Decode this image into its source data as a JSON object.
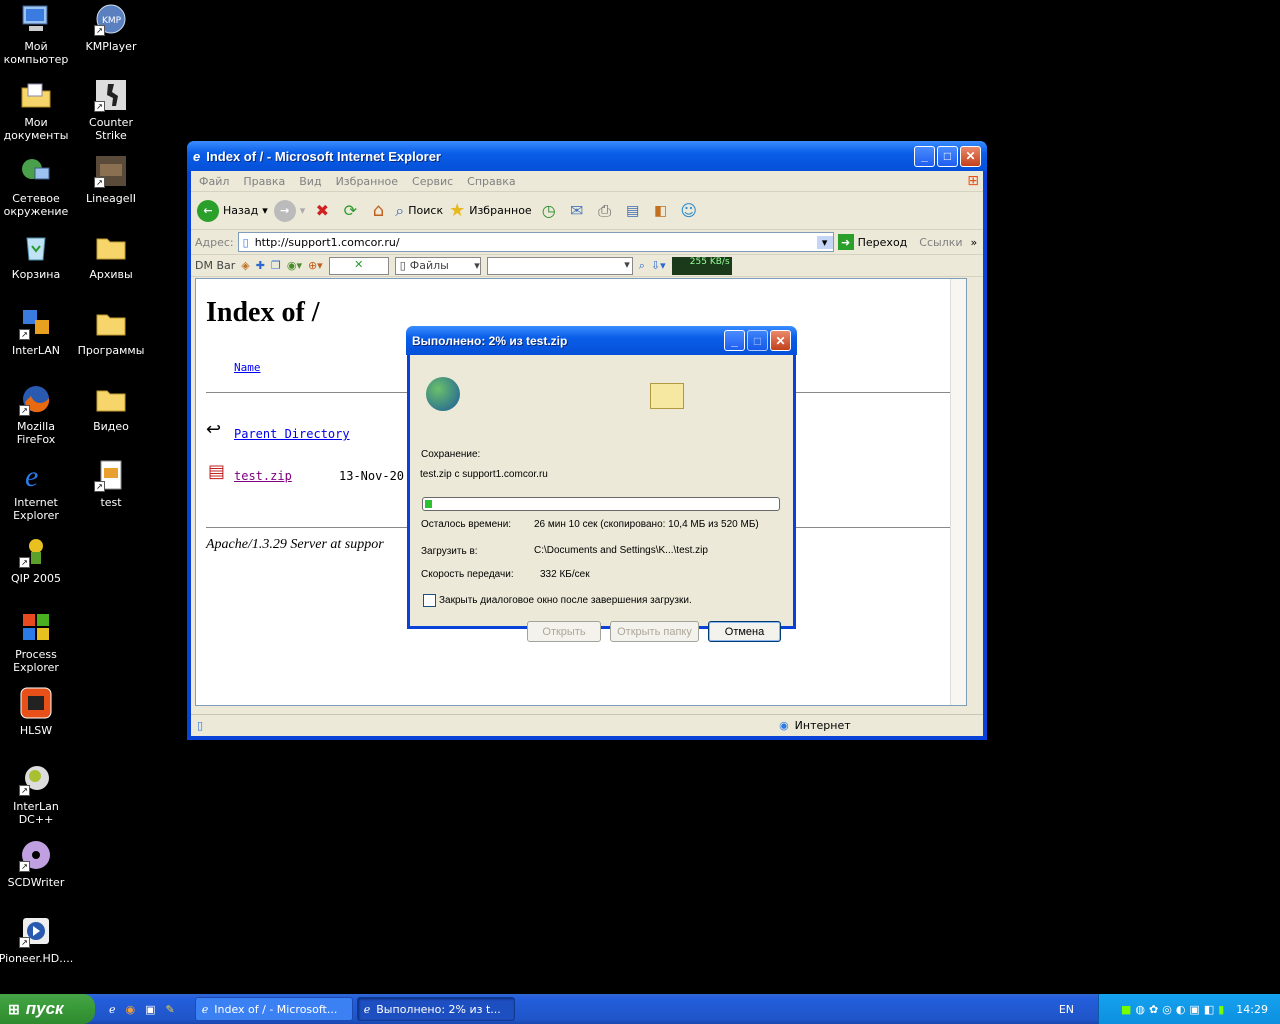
{
  "desktop": {
    "icons": [
      {
        "label1": "Мой",
        "label2": "компьютер"
      },
      {
        "label1": "Мои",
        "label2": "документы"
      },
      {
        "label1": "Сетевое",
        "label2": "окружение"
      },
      {
        "label1": "Корзина",
        "label2": ""
      },
      {
        "label1": "InterLAN",
        "label2": ""
      },
      {
        "label1": "Mozilla FireFox",
        "label2": ""
      },
      {
        "label1": "Internet",
        "label2": "Explorer"
      },
      {
        "label1": "QIP 2005",
        "label2": ""
      },
      {
        "label1": "Process",
        "label2": "Explorer"
      },
      {
        "label1": "HLSW",
        "label2": ""
      },
      {
        "label1": "InterLan",
        "label2": "DC++"
      },
      {
        "label1": "SCDWriter",
        "label2": ""
      },
      {
        "label1": "Pioneer.HD....",
        "label2": ""
      },
      {
        "label1": "KMPlayer",
        "label2": ""
      },
      {
        "label1": "Counter Strike",
        "label2": ""
      },
      {
        "label1": "LineageII",
        "label2": ""
      },
      {
        "label1": "Архивы",
        "label2": ""
      },
      {
        "label1": "Программы",
        "label2": ""
      },
      {
        "label1": "Видео",
        "label2": ""
      },
      {
        "label1": "test",
        "label2": ""
      }
    ]
  },
  "ie": {
    "title": "Index of / - Microsoft Internet Explorer",
    "menu": [
      "Файл",
      "Правка",
      "Вид",
      "Избранное",
      "Сервис",
      "Справка"
    ],
    "toolbar": {
      "back": "Назад",
      "search": "Поиск",
      "favorites": "Избранное"
    },
    "address_label": "Адрес:",
    "address_value": "http://support1.comcor.ru/",
    "go_label": "Переход",
    "links_label": "Ссылки",
    "dmbar": {
      "label": "DM Bar",
      "files": "Файлы",
      "speed": "255 KB/s"
    },
    "page": {
      "heading": "Index of /",
      "col_name": "Name",
      "parent": "Parent Directory",
      "file": "test.zip",
      "date": "13-Nov-20",
      "footer": "Apache/1.3.29 Server at suppor"
    },
    "status_zone": "Интернет"
  },
  "dialog": {
    "title": "Выполнено: 2% из test.zip",
    "saving_label": "Сохранение:",
    "saving_value": "test.zip с support1.comcor.ru",
    "progress": 0.02,
    "time_left_label": "Осталось времени:",
    "time_left_value": "26 мин 10 сек (скопировано: 10,4 МБ из 520 МБ)",
    "dest_label": "Загрузить в:",
    "dest_value": "C:\\Documents and Settings\\K...\\test.zip",
    "rate_label": "Скорость передачи:",
    "rate_value": "332 КБ/сек",
    "checkbox_label": "Закрыть диалоговое окно после завершения загрузки.",
    "btn_open": "Открыть",
    "btn_open_folder": "Открыть папку",
    "btn_cancel": "Отмена"
  },
  "taskbar": {
    "start": "пуск",
    "task1": "Index of / - Microsoft...",
    "task2": "Выполнено: 2% из t...",
    "lang": "EN",
    "clock": "14:29"
  }
}
